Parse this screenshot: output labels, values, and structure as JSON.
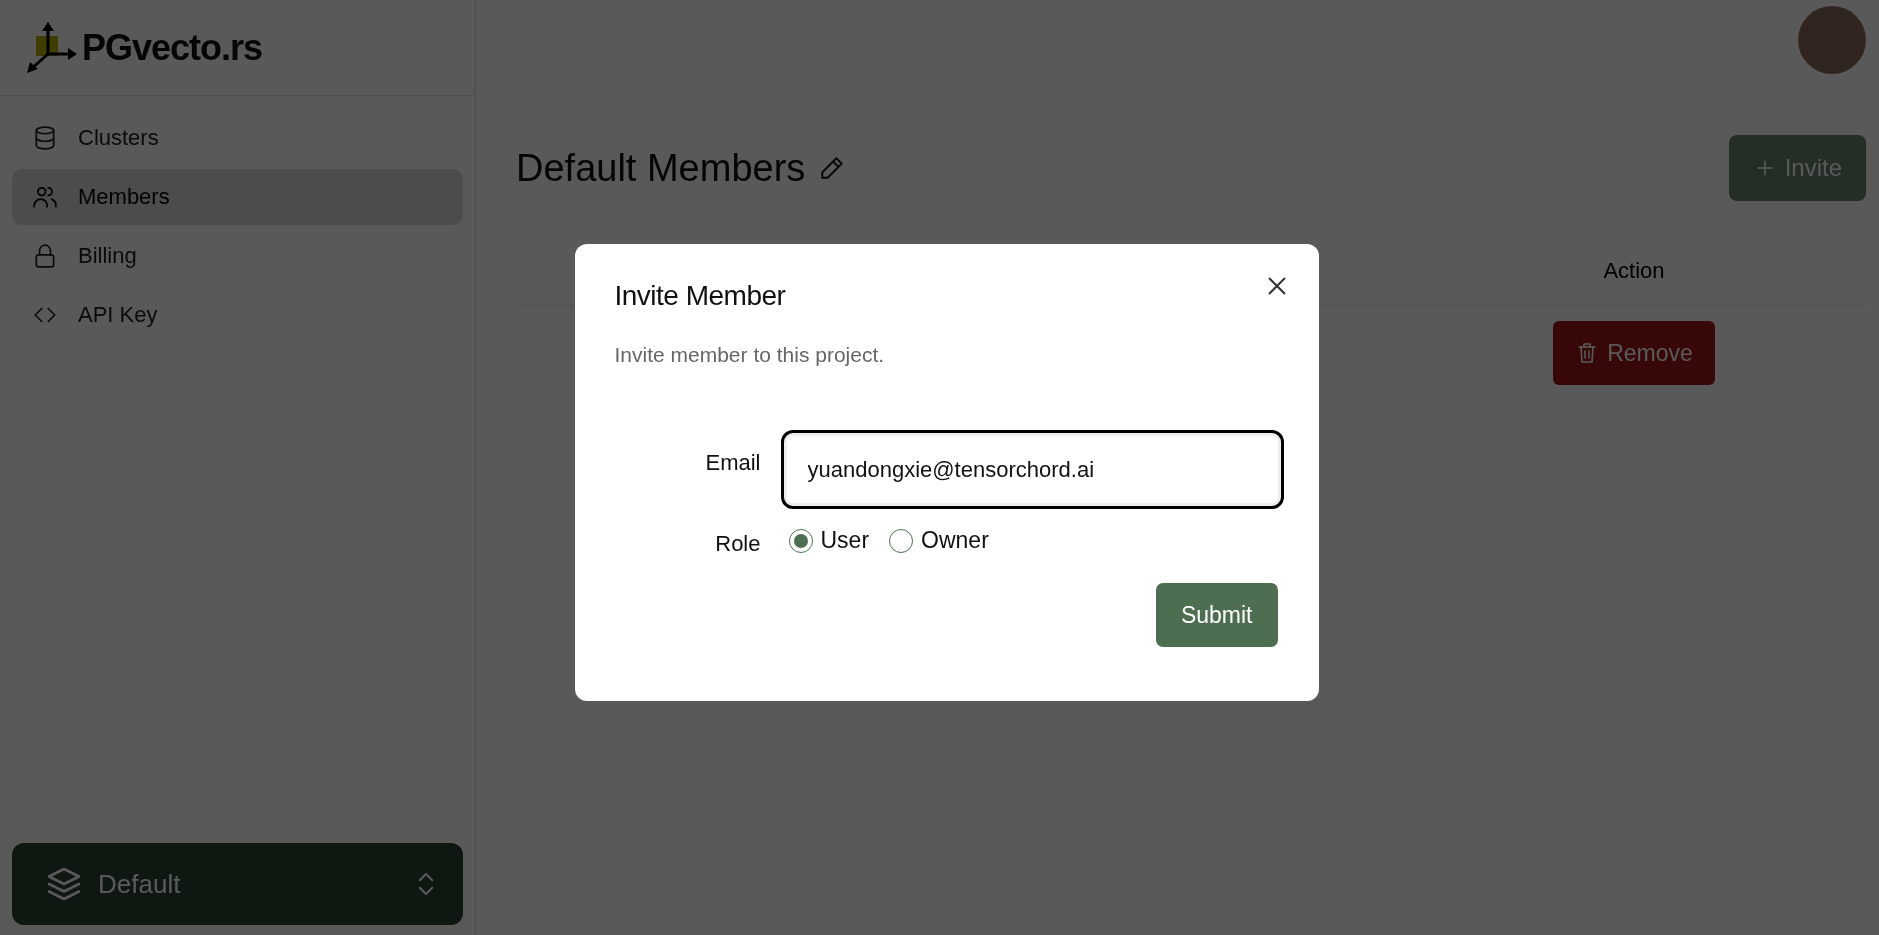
{
  "brand": {
    "name": "PGvecto.rs"
  },
  "sidebar": {
    "items": [
      {
        "label": "Clusters",
        "selected": false
      },
      {
        "label": "Members",
        "selected": true
      },
      {
        "label": "Billing",
        "selected": false
      },
      {
        "label": "API Key",
        "selected": false
      }
    ]
  },
  "project_switcher": {
    "label": "Default"
  },
  "page": {
    "title": "Default Members",
    "invite_button": "Invite",
    "table": {
      "columns": [
        {
          "label": "Action"
        }
      ],
      "rows": [
        {
          "action": "Remove"
        }
      ]
    }
  },
  "dialog": {
    "title": "Invite Member",
    "description": "Invite member to this project.",
    "email": {
      "label": "Email",
      "value": "yuandongxie@tensorchord.ai"
    },
    "role": {
      "label": "Role",
      "options": [
        {
          "label": "User",
          "selected": true
        },
        {
          "label": "Owner",
          "selected": false
        }
      ]
    },
    "submit": "Submit"
  }
}
